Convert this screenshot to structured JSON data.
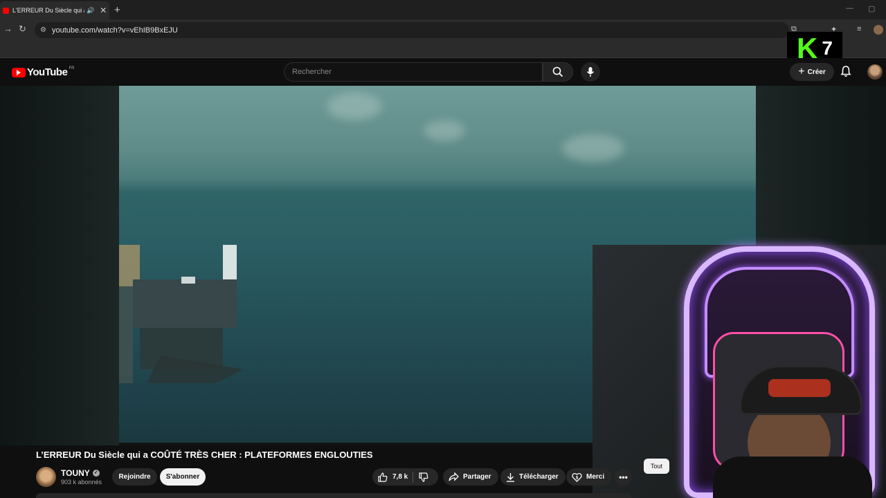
{
  "browser": {
    "tab_title": "L'ERREUR Du Siècle qui a CO",
    "url": "youtube.com/watch?v=vEhIB9BxEJU"
  },
  "overlay": {
    "k_letter": "K",
    "number": "7"
  },
  "youtube": {
    "logo_text": "YouTube",
    "country_code": "FR",
    "search_placeholder": "Rechercher",
    "create_label": "Créer"
  },
  "video": {
    "title": "L’ERREUR Du Siècle qui a COÛTÉ TRÈS CHER : PLATEFORMES ENGLOUTIES",
    "channel_name": "TOUNY",
    "subscribers": "903 k abonnés",
    "join_label": "Rejoindre",
    "subscribe_label": "S'abonner",
    "likes": "7,8 k",
    "share_label": "Partager",
    "download_label": "Télécharger",
    "thanks_label": "Merci",
    "more_label": "•••"
  },
  "chips": {
    "all_label": "Tout"
  },
  "colors": {
    "brand_red": "#ff0000",
    "kick_green": "#53fc18"
  }
}
